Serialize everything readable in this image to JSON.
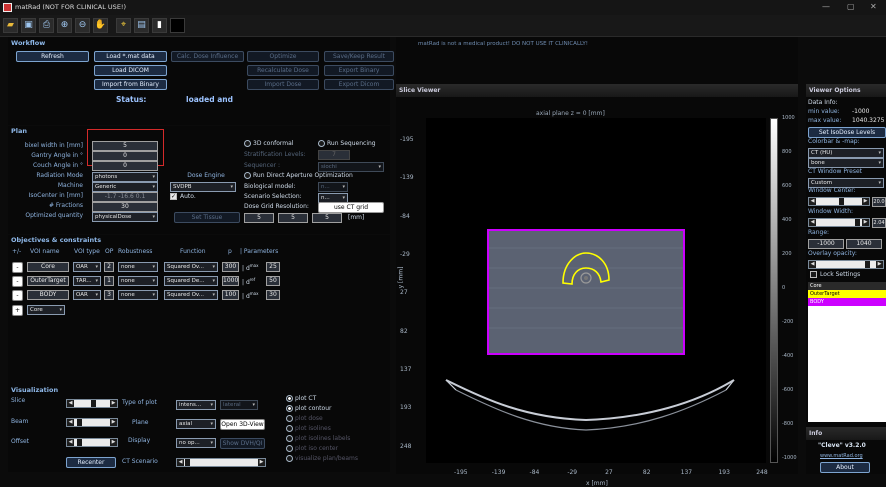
{
  "window": {
    "title": "matRad (NOT FOR CLINICAL USE!)",
    "controls": [
      "—",
      "▢",
      "✕"
    ]
  },
  "toolbar": {
    "icons": [
      "open-folder",
      "save",
      "print",
      "zoom-in",
      "zoom-out",
      "pan",
      "data-cursor",
      "colorbar",
      "legend",
      "blank"
    ]
  },
  "workflow": {
    "title": "Workflow",
    "refresh": "Refresh",
    "load_mat": "Load *.mat data",
    "calc_dose": "Calc. Dose Influence",
    "optimize": "Optimize",
    "save_result": "Save/Keep Result",
    "load_dicom": "Load DICOM",
    "recalc": "Recalculate Dose",
    "export_binary": "Export Binary",
    "import_binary": "Import from Binary",
    "import_dose": "Import Dose",
    "export_dicom": "Export Dicom",
    "status_label": "Status:",
    "status_value": "loaded and"
  },
  "warning": "matRad is not a medical product! DO NOT USE IT CLINICALLY!",
  "plan": {
    "title": "Plan",
    "labels": [
      "bixel width in [mm]",
      "Gantry Angle in °",
      "Couch Angle in °",
      "Radiation Mode",
      "Machine",
      "IsoCenter in [mm]",
      "# Fractions",
      "Optimized quantity"
    ],
    "values": {
      "bixel": "5",
      "gantry": "0",
      "couch": "0",
      "mode": "photons",
      "machine": "Generic",
      "iso": "-1.7 -16.6 0.1",
      "fractions": "30",
      "quantity": "physicalDose"
    },
    "set_tissue": "Set Tissue",
    "dose_engine_label": "Dose Engine",
    "dose_engine": "SVDPB",
    "auto": "Auto.",
    "conformal": "3D conformal",
    "run_seq": "Run Sequencing",
    "strat": "Stratification Levels:",
    "strat_val": "7",
    "sequencer": "Sequencer :",
    "sequencer_val": "siochi",
    "run_dao": "Run Direct Aperture Optimization",
    "bio_model": "Biological model:",
    "bio_val": "n...",
    "scenario": "Scenario Selection:",
    "scenario_val": "n...",
    "grid_res": "Dose Grid Resolution:",
    "use_ct": "use CT grid",
    "grid": [
      "5",
      "5",
      "5"
    ],
    "grid_unit": "[mm]"
  },
  "objectives": {
    "title": "Objectives & constraints",
    "headers": [
      "+/-",
      "VOI name",
      "VOI type",
      "OP",
      "Robustness",
      "Function",
      "p",
      "| Parameters"
    ],
    "rows": [
      {
        "name": "Core",
        "type": "OAR",
        "op": "2",
        "rob": "none",
        "fn": "Squared Ov...",
        "p": "300",
        "param": "d",
        "sup": "max",
        "val": "25"
      },
      {
        "name": "OuterTarget",
        "type": "TAR...",
        "op": "1",
        "rob": "none",
        "fn": "Squared De...",
        "p": "1000",
        "param": "d",
        "sup": "ref",
        "val": "50"
      },
      {
        "name": "BODY",
        "type": "OAR",
        "op": "3",
        "rob": "none",
        "fn": "Squared Ov...",
        "p": "100",
        "param": "d",
        "sup": "max",
        "val": "30"
      }
    ],
    "add": "+",
    "add_voi": "Core"
  },
  "visualization": {
    "title": "Visualization",
    "slice": "Slice",
    "beam": "Beam",
    "offset": "Offset",
    "type_plot": "Type of plot",
    "type_val": "intens...",
    "lateral": "lateral",
    "plane": "Plane",
    "plane_val": "axial",
    "open3d": "Open 3D-View",
    "display": "Display",
    "display_val": "no op...",
    "show_dvh": "Show DVH/QI",
    "recenter": "Recenter",
    "ct_scen": "CT Scenario",
    "checks": [
      "plot CT",
      "plot contour",
      "plot dose",
      "plot isolines",
      "plot isolines labels",
      "plot iso center",
      "visualize plan/beams"
    ]
  },
  "viewer": {
    "title": "Slice Viewer",
    "plot_title": "axial plane z = 0 [mm]",
    "xlabel": "x [mm]",
    "ylabel": "y [mm]",
    "xticks": [
      "-195",
      "-139",
      "-84",
      "-29",
      "27",
      "82",
      "137",
      "193",
      "248"
    ],
    "yticks": [
      "-195",
      "-139",
      "-84",
      "-29",
      "27",
      "82",
      "137",
      "193",
      "248"
    ],
    "cticks": [
      "1000",
      "800",
      "600",
      "400",
      "200",
      "0",
      "-200",
      "-400",
      "-600",
      "-800",
      "-1000"
    ]
  },
  "options": {
    "title": "Viewer Options",
    "data_info": "Data Info:",
    "min_label": "min value:",
    "min": "-1000",
    "max_label": "max value:",
    "max": "1040.3275",
    "set_iso": "Set IsoDose Levels",
    "colorbar": "Colorbar & -map:",
    "cmap": "CT (HU)",
    "cmap2": "bone",
    "ct_window": "CT Window Preset",
    "preset": "Custom",
    "win_center": "Window Center:",
    "center_val": "20.0",
    "win_width": "Window Width:",
    "width_val": "2.04",
    "range": "Range:",
    "range_min": "-1000",
    "range_max": "1040",
    "overlay": "Overlay opacity:",
    "lock": "Lock Settings",
    "legend": [
      {
        "name": "Core",
        "color": "#2a2a2a"
      },
      {
        "name": "OuterTarget",
        "color": "#ffff00"
      },
      {
        "name": "BODY",
        "color": "#cc00ff"
      }
    ]
  },
  "info": {
    "title": "Info",
    "version": "\"Cleve\" v3.2.0",
    "link": "www.matRad.org",
    "about": "About"
  }
}
